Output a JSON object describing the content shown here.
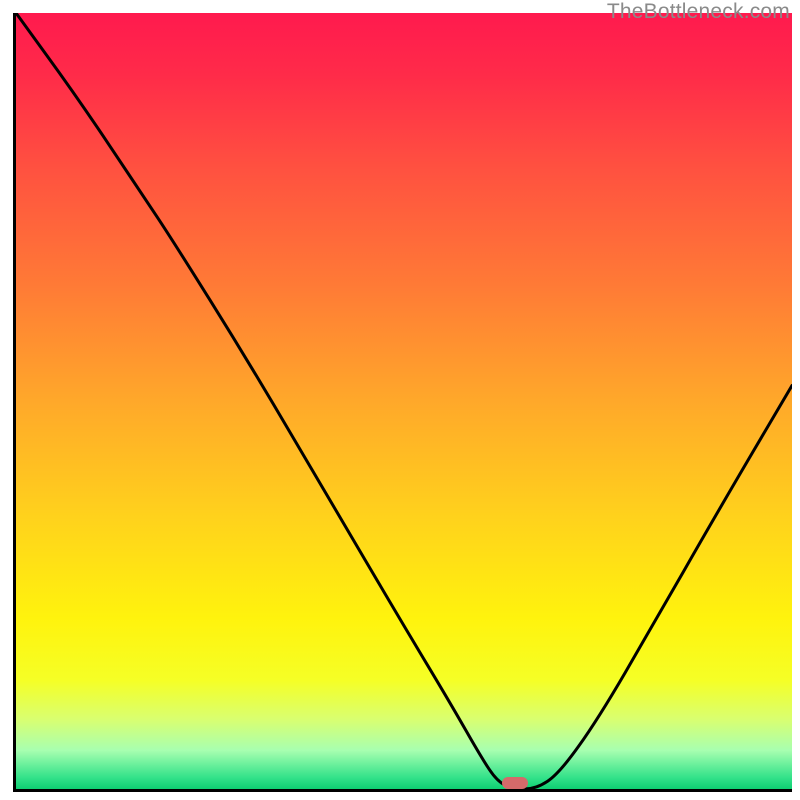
{
  "watermark": "TheBottleneck.com",
  "marker": {
    "color": "#d46a6a",
    "x_fraction": 0.643,
    "y_fraction": 0.992
  },
  "gradient_stops": [
    {
      "offset": 0.0,
      "color": "#ff1a4e"
    },
    {
      "offset": 0.08,
      "color": "#ff2b49"
    },
    {
      "offset": 0.2,
      "color": "#ff5140"
    },
    {
      "offset": 0.35,
      "color": "#ff7a36"
    },
    {
      "offset": 0.5,
      "color": "#ffa82a"
    },
    {
      "offset": 0.65,
      "color": "#ffd21c"
    },
    {
      "offset": 0.78,
      "color": "#fff30d"
    },
    {
      "offset": 0.86,
      "color": "#f5ff26"
    },
    {
      "offset": 0.91,
      "color": "#d9ff70"
    },
    {
      "offset": 0.95,
      "color": "#a8ffb0"
    },
    {
      "offset": 0.985,
      "color": "#34e28a"
    },
    {
      "offset": 1.0,
      "color": "#0ecf72"
    }
  ],
  "chart_data": {
    "type": "line",
    "title": "",
    "xlabel": "",
    "ylabel": "",
    "xlim": [
      0,
      100
    ],
    "ylim": [
      0,
      100
    ],
    "grid": false,
    "legend": false,
    "annotations": [
      "TheBottleneck.com"
    ],
    "series": [
      {
        "name": "curve",
        "x": [
          0,
          8,
          16,
          20,
          30,
          40,
          50,
          56,
          60,
          62,
          64,
          67,
          70,
          75,
          82,
          90,
          100
        ],
        "values": [
          100,
          89,
          77,
          71,
          55,
          38,
          21,
          11,
          4,
          1,
          0,
          0,
          2,
          9,
          21,
          35,
          52
        ]
      }
    ],
    "markers": [
      {
        "name": "highlight",
        "x": 64.3,
        "y": 0.8,
        "color": "#d46a6a"
      }
    ]
  }
}
